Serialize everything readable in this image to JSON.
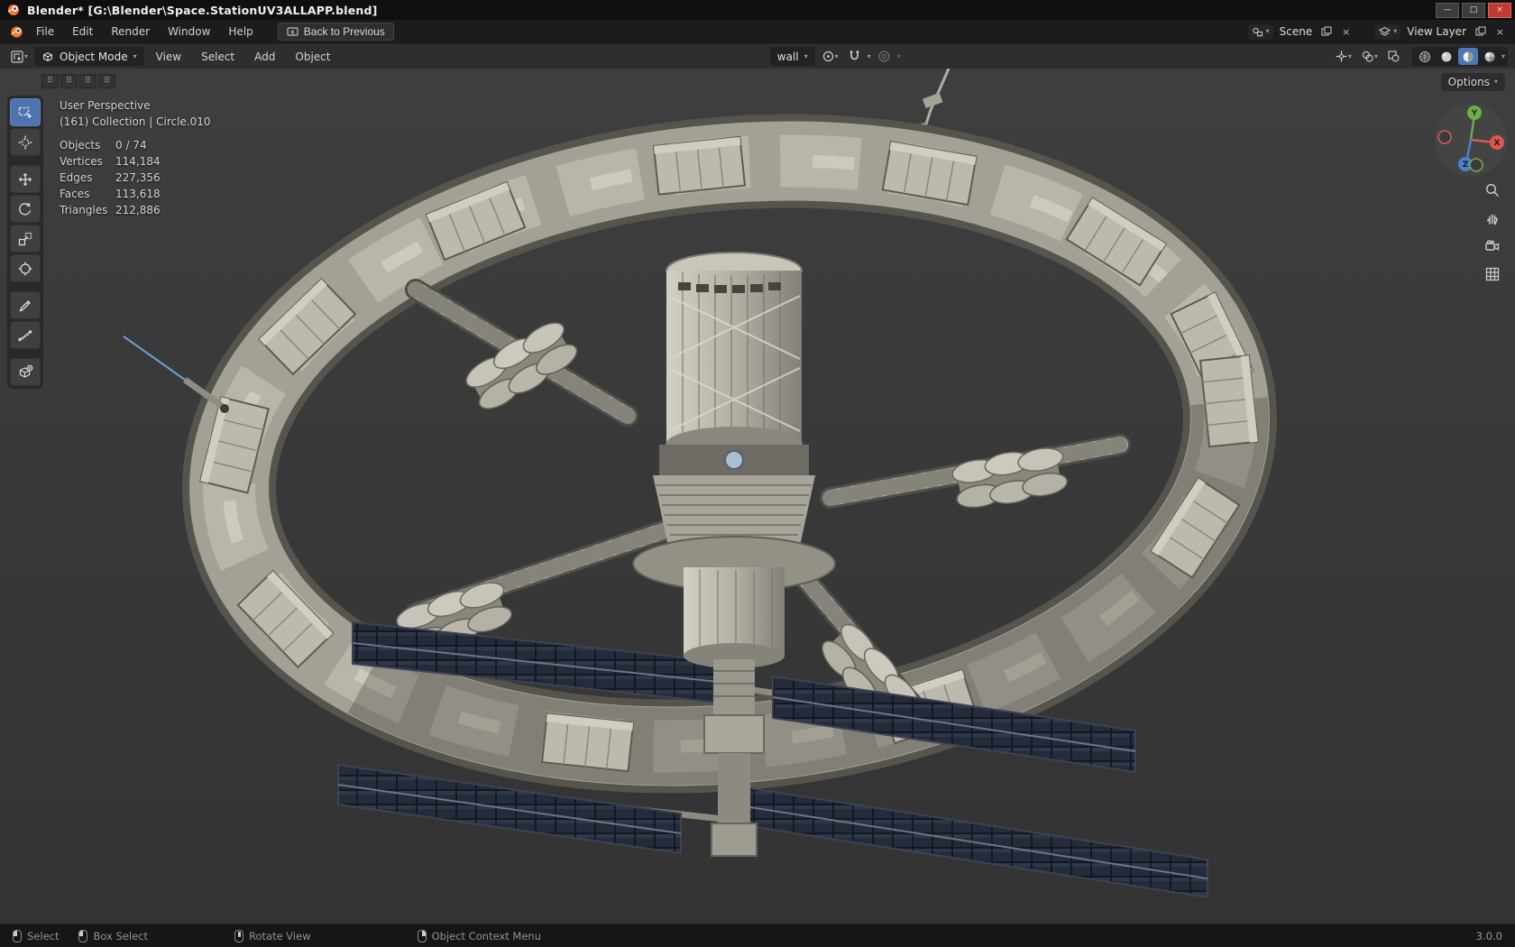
{
  "window": {
    "title": "Blender* [G:\\Blender\\Space.StationUV3ALLAPP.blend]"
  },
  "icons": {
    "caret": "▾",
    "dots": "⠿",
    "close": "×",
    "minimize": "—",
    "maximize": "□"
  },
  "topbar": {
    "menus": [
      "File",
      "Edit",
      "Render",
      "Window",
      "Help"
    ],
    "back_button": "Back to Previous",
    "scene_label": "Scene",
    "view_layer_label": "View Layer"
  },
  "header": {
    "mode": "Object Mode",
    "menus": [
      "View",
      "Select",
      "Add",
      "Object"
    ],
    "orientation": "wall",
    "options_label": "Options"
  },
  "viewport": {
    "perspective_label": "User Perspective",
    "collection_label": "(161) Collection | Circle.010",
    "stats": [
      {
        "label": "Objects",
        "value": "0 / 74"
      },
      {
        "label": "Vertices",
        "value": "114,184"
      },
      {
        "label": "Edges",
        "value": "227,356"
      },
      {
        "label": "Faces",
        "value": "113,618"
      },
      {
        "label": "Triangles",
        "value": "212,886"
      }
    ],
    "gizmo_axes": {
      "x": "X",
      "y": "Y",
      "z": "Z"
    }
  },
  "statusbar": {
    "hints": [
      {
        "label": "Select"
      },
      {
        "label": "Box Select"
      },
      {
        "label": "Rotate View"
      },
      {
        "label": "Object Context Menu"
      }
    ],
    "version": "3.0.0"
  }
}
